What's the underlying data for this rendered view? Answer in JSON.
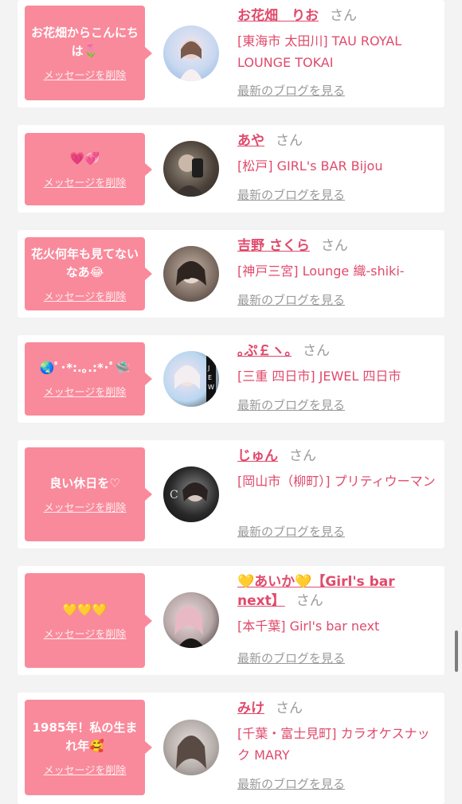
{
  "delete_label": "メッセージを削除",
  "honorific": "さん",
  "blog_label": "最新のブログを見る",
  "colors": {
    "accent": "#e04a6b",
    "bubble": "#f98a9b",
    "muted": "#9a9a9a"
  },
  "entries": [
    {
      "message": "お花畑からこんにちは🌷",
      "name": "お花畑　りお",
      "shop": "[東海市 太田川] TAU ROYAL LOUNGE TOKAI"
    },
    {
      "message": "💗💞",
      "name": "あや",
      "shop": "[松戸] GIRL's BAR Bijou"
    },
    {
      "message": "花火何年も見てないなあ😂",
      "name": "吉野 さくら",
      "shop": "[神戸三宮] Lounge 織-shiki-"
    },
    {
      "message": "🌏ﾟ･*:.｡.:*･ﾟ🛸",
      "name": "｡ぷ￡ヽ｡",
      "shop": "[三重 四日市] JEWEL 四日市"
    },
    {
      "message": "良い休日を♡",
      "name": "じゅん",
      "shop": "[岡山市（柳町）] プリティウーマン"
    },
    {
      "message": "💛💛💛",
      "name": "💛あいか💛【Girl's bar next】",
      "shop": "[本千葉] Girl's bar next"
    },
    {
      "message": "1985年！私の生まれ年🥰",
      "name": "みけ",
      "shop": "[千葉・富士見町] カラオケスナック MARY"
    }
  ]
}
